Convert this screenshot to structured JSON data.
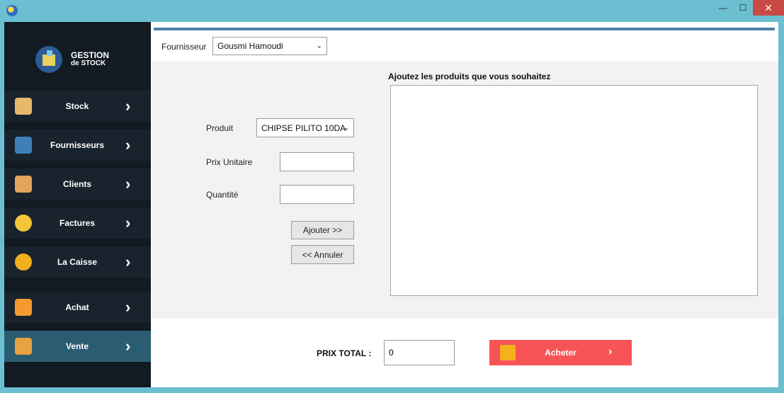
{
  "sidebar": {
    "logo": {
      "line1": "GESTION",
      "line2": "de STOCK"
    },
    "items": [
      {
        "label": "Stock"
      },
      {
        "label": "Fournisseurs"
      },
      {
        "label": "Clients"
      },
      {
        "label": "Factures"
      },
      {
        "label": "La Caisse"
      },
      {
        "label": "Achat"
      },
      {
        "label": "Vente"
      }
    ]
  },
  "main": {
    "supplier_label": "Fournisseur",
    "supplier_value": "Gousmi Hamoudi",
    "list_title": "Ajoutez les produits que vous souhaitez",
    "product_label": "Produit",
    "product_value": "CHIPSE PILITO 10DA",
    "price_label": "Prix Unitaire",
    "quantity_label": "Quantité",
    "add_button": "Ajouter >>",
    "cancel_button": "<< Annuler",
    "total_label": "PRIX TOTAL :",
    "total_value": "0",
    "buy_button": "Acheter"
  }
}
